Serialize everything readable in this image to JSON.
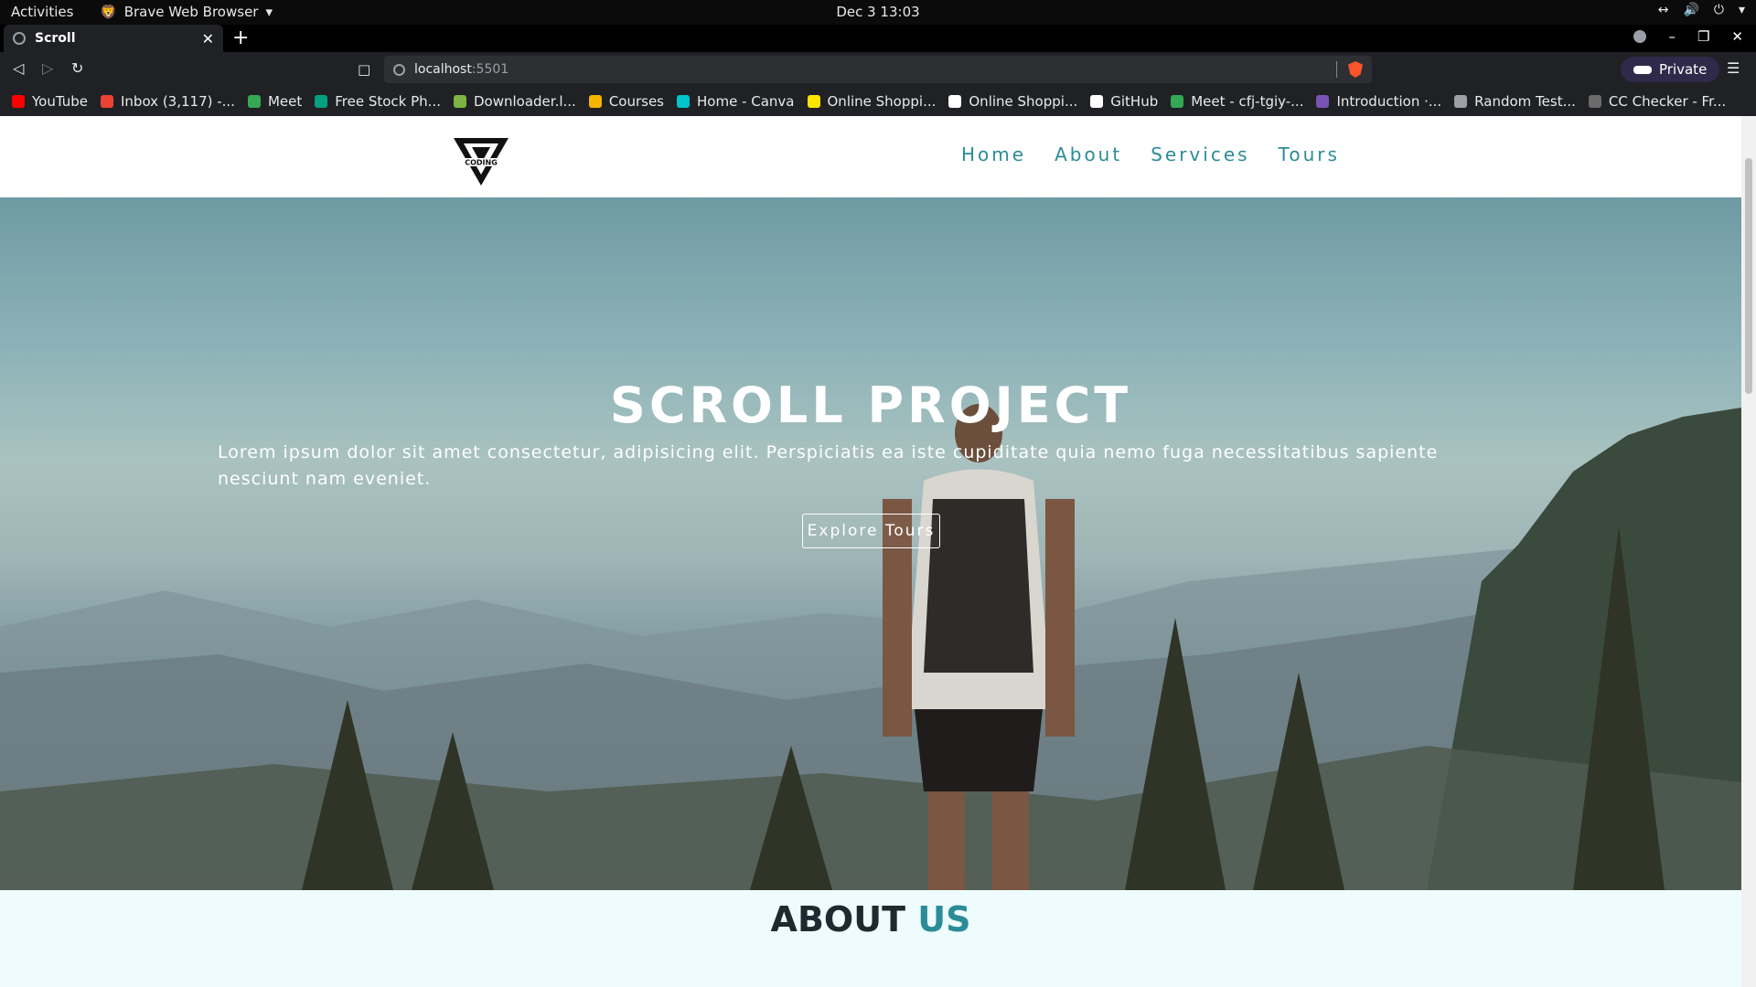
{
  "os": {
    "activities": "Activities",
    "app_name": "Brave Web Browser",
    "clock": "Dec 3  13:03"
  },
  "browser": {
    "tab_title": "Scroll",
    "url_host": "localhost",
    "url_port": ":5501",
    "private_label": "Private",
    "bookmarks": [
      {
        "label": "YouTube",
        "color": "#ff0000"
      },
      {
        "label": "Inbox (3,117) -...",
        "color": "#ea4335"
      },
      {
        "label": "Meet",
        "color": "#34a853"
      },
      {
        "label": "Free Stock Ph...",
        "color": "#05a081"
      },
      {
        "label": "Downloader.l...",
        "color": "#7cb342"
      },
      {
        "label": "Courses",
        "color": "#f4b400"
      },
      {
        "label": "Home - Canva",
        "color": "#00c4cc"
      },
      {
        "label": "Online Shoppi...",
        "color": "#ffe500"
      },
      {
        "label": "Online Shoppi...",
        "color": "#ffffff"
      },
      {
        "label": "GitHub",
        "color": "#ffffff"
      },
      {
        "label": "Meet - cfj-tgiy-...",
        "color": "#34a853"
      },
      {
        "label": "Introduction ·...",
        "color": "#7952b3"
      },
      {
        "label": "Random Test...",
        "color": "#9aa0a6"
      },
      {
        "label": "CC Checker - Fr...",
        "color": "#6b6b6b"
      }
    ]
  },
  "site": {
    "logo_text": "CODING",
    "nav": [
      "Home",
      "About",
      "Services",
      "Tours"
    ],
    "hero": {
      "title": "SCROLL PROJECT",
      "text": "Lorem ipsum dolor sit amet consectetur, adipisicing elit. Perspiciatis ea iste cupiditate quia nemo fuga necessitatibus sapiente nesciunt nam eveniet.",
      "button": "Explore Tours"
    },
    "about": {
      "title_1": "ABOUT",
      "title_2": "US"
    },
    "accent_color": "#2a8c97"
  }
}
